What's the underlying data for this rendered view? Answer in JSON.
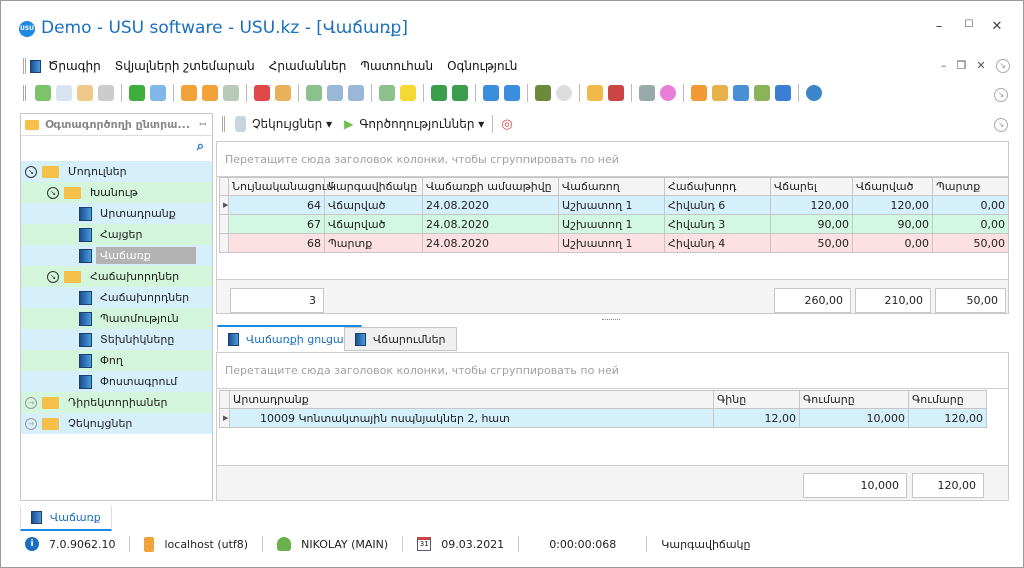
{
  "window": {
    "title": "Demo - USU software - USU.kz - [Վաճառք]",
    "logo": "USU",
    "minimize": "–",
    "maximize": "☐",
    "close": "✕"
  },
  "menu": [
    "Ծրագիր",
    "Տվյալների շտեմարան",
    "Հրամաններ",
    "Պատուհան",
    "Օգնություն"
  ],
  "toolbar_icons": [
    {
      "name": "add-icon",
      "color": "#7cc36a"
    },
    {
      "name": "copy-icon",
      "color": "#d9e4f2"
    },
    {
      "name": "edit-icon",
      "color": "#f0c98a"
    },
    {
      "name": "delete-icon",
      "color": "#ccc"
    },
    "sep",
    {
      "name": "refresh-icon",
      "color": "#3fae3f"
    },
    {
      "name": "search-icon",
      "color": "#7fb8e8"
    },
    "sep",
    {
      "name": "filter-icon",
      "color": "#f2a23a"
    },
    {
      "name": "filter-clear-icon",
      "color": "#f2a23a"
    },
    {
      "name": "filter-check-icon",
      "color": "#b9c9b9"
    },
    "sep",
    {
      "name": "flag-icon",
      "color": "#e24747"
    },
    {
      "name": "image-icon",
      "color": "#e8b25a"
    },
    "sep",
    {
      "name": "columns-icon",
      "color": "#8cc08c"
    },
    {
      "name": "expand-icon",
      "color": "#9bb7d8"
    },
    {
      "name": "collapse-icon",
      "color": "#9bb7d8"
    },
    "sep",
    {
      "name": "add-column-icon",
      "color": "#8cc08c"
    },
    {
      "name": "note-icon",
      "color": "#f5d933"
    },
    "sep",
    {
      "name": "excel-export-icon",
      "color": "#3c9d4e"
    },
    {
      "name": "excel-import-icon",
      "color": "#3c9d4e"
    },
    "sep",
    {
      "name": "close-window-icon",
      "color": "#3a8edb"
    },
    {
      "name": "close-all-windows-icon",
      "color": "#3a8edb"
    },
    "sep",
    {
      "name": "exit-icon",
      "color": "#6b8a3b"
    },
    {
      "name": "arrow-circle-icon",
      "color": "#ddd"
    },
    "sep",
    {
      "name": "location-pin-icon",
      "color": "#f2b84a"
    },
    {
      "name": "calendar-icon",
      "color": "#c44"
    },
    "sep",
    {
      "name": "gear-icon",
      "color": "#9aa"
    },
    {
      "name": "color-wheel-icon",
      "color": "#e87ed8"
    },
    "sep",
    {
      "name": "rss-icon",
      "color": "#f29a33"
    },
    {
      "name": "lock-icon",
      "color": "#e8b24a"
    },
    {
      "name": "user-key-icon",
      "color": "#4a8fd4"
    },
    {
      "name": "users-icon",
      "color": "#89b45a"
    },
    {
      "name": "plugin-icon",
      "color": "#3a7fd4"
    },
    "sep",
    {
      "name": "info-icon",
      "color": "#3a86c8"
    }
  ],
  "left_panel": {
    "title": "Օգտագործողի ընտրա...",
    "pin": "📌",
    "tree": [
      {
        "label": "Մոդուլներ",
        "level": 0,
        "type": "folder-open",
        "expander": "expanded",
        "bg": "b"
      },
      {
        "label": "Խանութ",
        "level": 1,
        "type": "folder-open",
        "expander": "expanded",
        "bg": "g"
      },
      {
        "label": "Արտադրանք",
        "level": 2,
        "type": "book",
        "bg": "b"
      },
      {
        "label": "Հայցեր",
        "level": 2,
        "type": "book",
        "bg": "g"
      },
      {
        "label": "Վաճառք",
        "level": 2,
        "type": "book",
        "bg": "b",
        "selected": true
      },
      {
        "label": "Հաճախորդներ",
        "level": 1,
        "type": "folder-open",
        "expander": "expanded",
        "bg": "g"
      },
      {
        "label": "Հաճախորդներ",
        "level": 2,
        "type": "book",
        "bg": "b"
      },
      {
        "label": "Պատմություն",
        "level": 2,
        "type": "book",
        "bg": "g"
      },
      {
        "label": "Տեխնիկները",
        "level": 2,
        "type": "book",
        "bg": "b"
      },
      {
        "label": "Փող",
        "level": 2,
        "type": "book",
        "bg": "g"
      },
      {
        "label": "Փոստագրում",
        "level": 2,
        "type": "book",
        "bg": "b"
      },
      {
        "label": "Դիրեկտորիաներ",
        "level": 0,
        "type": "folder",
        "expander": "collapsed",
        "bg": "g"
      },
      {
        "label": "Չեկույցներ",
        "level": 0,
        "type": "folder",
        "expander": "collapsed",
        "bg": "b"
      }
    ]
  },
  "right_toolbar": {
    "reports": "Չեկույցներ",
    "actions": "Գործողություններ"
  },
  "sales_grid": {
    "group_hint": "Перетащите сюда заголовок колонки, чтобы сгруппировать по ней",
    "columns": [
      "Նույնականացում",
      "Կարգավիճակը",
      "Վաճառքի ամսաթիվը",
      "Վաճառող",
      "Հաճախորդ",
      "Վճարել",
      "Վճարված",
      "Պարտք"
    ],
    "rows": [
      {
        "cells": [
          "64",
          "Վճարված",
          "24.08.2020",
          "Աշխատող 1",
          "Հիվանդ 6",
          "120,00",
          "120,00",
          "0,00"
        ],
        "color": "b"
      },
      {
        "cells": [
          "67",
          "Վճարված",
          "24.08.2020",
          "Աշխատող 1",
          "Հիվանդ 3",
          "90,00",
          "90,00",
          "0,00"
        ],
        "color": "g"
      },
      {
        "cells": [
          "68",
          "Պարտք",
          "24.08.2020",
          "Աշխատող 1",
          "Հիվանդ 4",
          "50,00",
          "0,00",
          "50,00"
        ],
        "color": "r"
      }
    ],
    "footer": {
      "count": "3",
      "to_pay": "260,00",
      "paid": "210,00",
      "debt": "50,00"
    }
  },
  "tabs": [
    {
      "label": "Վաճառքի ցուցակ",
      "active": true
    },
    {
      "label": "Վճարումներ",
      "active": false
    }
  ],
  "items_grid": {
    "group_hint": "Перетащите сюда заголовок колонки, чтобы сгруппировать по ней",
    "columns": [
      "Արտադրանք",
      "Գինը",
      "Գումարը",
      "Գումարը"
    ],
    "rows": [
      {
        "cells": [
          "10009 Կոնտակտային ոսպնյակներ 2, հատ",
          "12,00",
          "10,000",
          "120,00"
        ]
      }
    ],
    "footer": {
      "quantity": "10,000",
      "sum": "120,00"
    }
  },
  "bottom_tab": "Վաճառք",
  "status": {
    "version": "7.0.9062.10",
    "server": "localhost (utf8)",
    "user": "NIKOLAY (MAIN)",
    "date": "09.03.2021",
    "timer": "0:00:00:068",
    "state": "Կարգավիճակը"
  }
}
